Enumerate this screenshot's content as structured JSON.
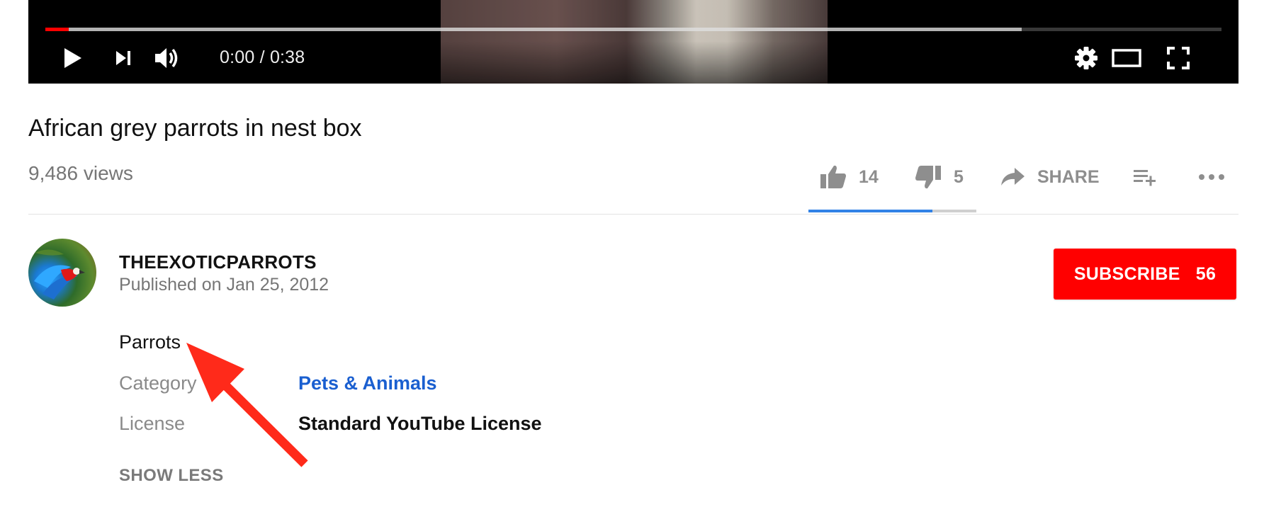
{
  "player": {
    "time_current": "0:00",
    "time_separator": "/",
    "time_total": "0:38",
    "played_fraction": 0.02,
    "buffered_fraction": 0.83,
    "icons": [
      "play-icon",
      "next-icon",
      "volume-icon",
      "settings-icon",
      "theater-mode-icon",
      "fullscreen-icon"
    ]
  },
  "video": {
    "title": "African grey parrots in nest box",
    "views": "9,486 views"
  },
  "actions": {
    "like_count": "14",
    "dislike_count": "5",
    "share_label": "SHARE",
    "like_ratio": 0.74
  },
  "owner": {
    "channel_name": "THEEXOTICPARROTS",
    "published": "Published on Jan 25, 2012",
    "subscribe_label": "SUBSCRIBE",
    "subscriber_count": "56"
  },
  "description": {
    "text": "Parrots",
    "category_label": "Category",
    "category_value": "Pets & Animals",
    "license_label": "License",
    "license_value": "Standard YouTube License",
    "show_less_label": "SHOW LESS"
  },
  "colors": {
    "brand_red": "#ff0000",
    "link_blue": "#1a5fd0",
    "like_bar_blue": "#3282e6",
    "annotation_arrow": "#ff2a1a"
  }
}
